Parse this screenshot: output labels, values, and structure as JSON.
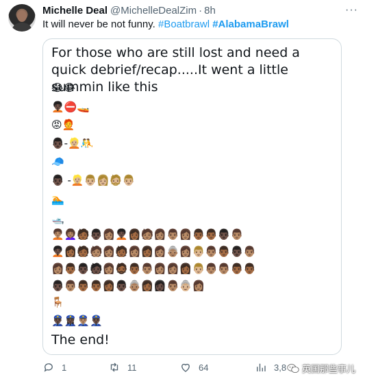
{
  "tweet": {
    "author_name": "Michelle Deal",
    "author_handle": "@MichelleDealZim",
    "separator": "·",
    "time": "8h",
    "more_icon": "···",
    "text_plain": "It will never be not funny. ",
    "hashtag_1": "#Boatbrawl",
    "hashtag_2": "#AlabamaBrawl"
  },
  "card": {
    "title": "For those who are still lost and need a quick debrief/recap.....It went a little summin like this",
    "rows": [
      "😂😂",
      "🧑🏿‍🦱⛔🚤",
      "😡🧑‍🦰",
      "👨🏿-👱🏼🤼",
      "🧢",
      "👨🏿 -👱🏼👨🏼👩🏼🧔🏼👨🏼",
      "🏊",
      "🛥️",
      "🧑🏽‍🦱👩🏽‍🦱🧑🏾👨🏿👩🏽🧑🏿‍🦱👩🏾🧑🏽👩🏽👨🏽👩🏽👨🏾👨🏾👨🏿👨🏽",
      "🧑🏿‍🦱👩🏾🧑🏾🧑🏽👩🏽🧑🏾👩🏽👩🏾👩🏽👵🏽👩🏽👨🏼👨🏽👨🏾👨🏿👨🏽",
      "👩🏽👨🏾👨🏿🧑🏿👩🏽🧔🏾👨🏾👨🏽👩🏽👩🏽👩🏾👨🏼👨🏽👨🏽👨🏾👨🏾",
      "👨🏿👨🏽👨🏾👨🏾👩🏾👨🏿👵🏽👩🏾👩🏿👨🏽👵🏼👩🏽",
      "🪑",
      "👮🏿‍♂️👮🏿‍♀️👮🏽‍♂️👮🏿‍♂️"
    ],
    "ending": "The end!"
  },
  "actions": {
    "reply_count": "1",
    "retweet_count": "11",
    "like_count": "64",
    "views_count": "3,8"
  },
  "watermark": {
    "text": "英国那些事儿"
  },
  "colors": {
    "link": "#1d9bf0",
    "secondary_text": "#536471",
    "border": "#cfd9de",
    "primary_text": "#0f1419"
  }
}
